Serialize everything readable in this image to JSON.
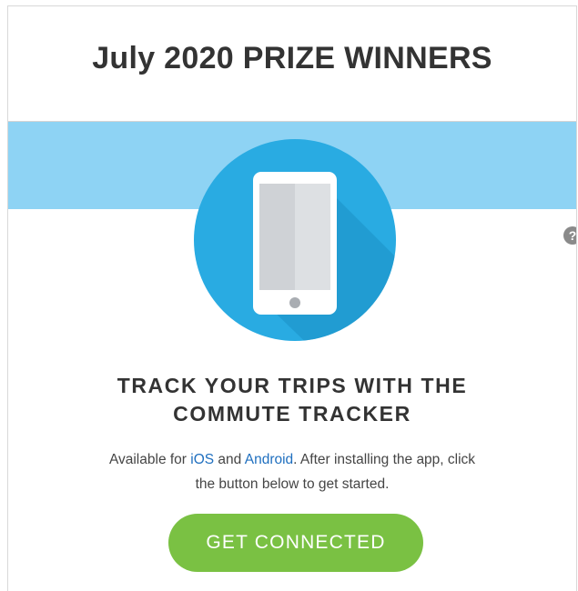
{
  "header": {
    "title": "July 2020 PRIZE WINNERS"
  },
  "colors": {
    "band": "#8ed3f4",
    "circle": "#29abe2",
    "button": "#7ac143",
    "link": "#1f6fbf"
  },
  "hero": {
    "icon": "smartphone-icon",
    "help_icon": "question-mark-icon"
  },
  "help": {
    "label": "?"
  },
  "content": {
    "headline_line1": "TRACK YOUR TRIPS WITH THE",
    "headline_line2": "COMMUTE TRACKER",
    "desc_prefix": "Available for ",
    "ios_link": "iOS",
    "desc_and": " and ",
    "android_link": "Android",
    "desc_line1_end": ". After installing the app, click",
    "desc_line2": "the button below to get started."
  },
  "cta": {
    "label": "GET CONNECTED"
  }
}
